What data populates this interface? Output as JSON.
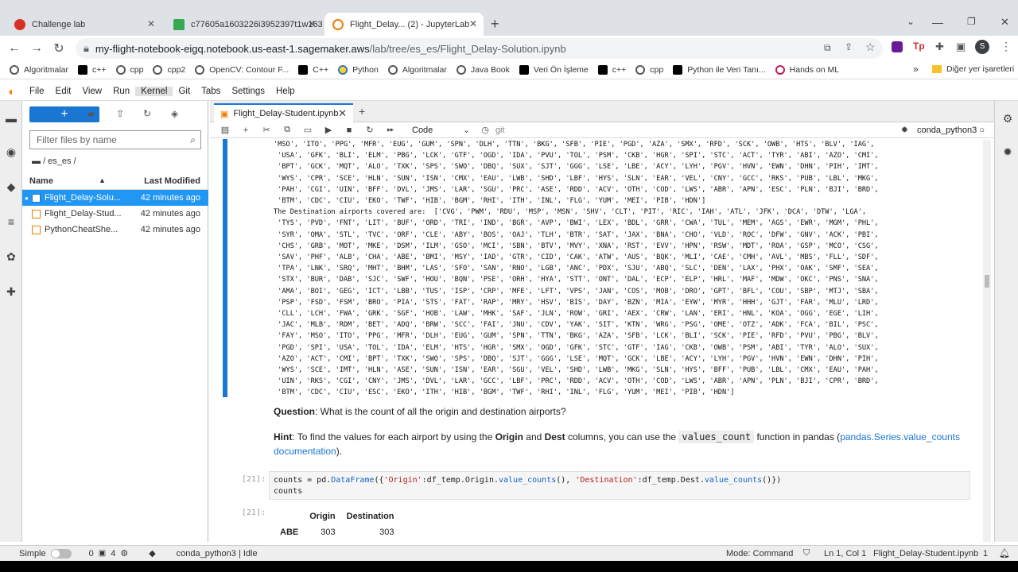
{
  "browser": {
    "tabs": [
      {
        "title": "Challenge lab",
        "icon": "red-circle-icon"
      },
      {
        "title": "c77605a1603226i3952397t1w1632:",
        "icon": "green-square-icon"
      },
      {
        "title": "Flight_Delay... (2) - JupyterLab",
        "icon": "jupyter-icon"
      }
    ],
    "url_host": "my-flight-notebook-eigq.notebook.us-east-1.sagemaker.aws",
    "url_path": "/lab/tree/es_es/Flight_Delay-Solution.ipynb",
    "bookmarks": [
      "Algoritmalar",
      "c++",
      "cpp",
      "cpp2",
      "OpenCV: Contour F...",
      "C++",
      "Python",
      "Algoritmalar",
      "Java Book",
      "Veri Ön İşleme",
      "c++",
      "cpp",
      "Python ile Veri Tanı...",
      "Hands on ML"
    ],
    "bookmarks_more": "Diğer yer işaretleri",
    "profile_letter": "S"
  },
  "menu": [
    "File",
    "Edit",
    "View",
    "Run",
    "Kernel",
    "Git",
    "Tabs",
    "Settings",
    "Help"
  ],
  "filebrowser": {
    "new_label": "+",
    "filter_placeholder": "Filter files by name",
    "breadcrumb": "/ es_es /",
    "col_name": "Name",
    "col_modified": "Last Modified",
    "files": [
      {
        "name": "Flight_Delay-Solu...",
        "modified": "42 minutes ago"
      },
      {
        "name": "Flight_Delay-Stud...",
        "modified": "42 minutes ago"
      },
      {
        "name": "PythonCheatShe...",
        "modified": "42 minutes ago"
      }
    ]
  },
  "notebook": {
    "tab_title": "Flight_Delay-Student.ipynb",
    "cell_type": "Code",
    "git_label": "git",
    "kernel": "conda_python3",
    "output_lines": [
      "'MSO', 'ITO', 'PPG', 'MFR', 'EUG', 'GUM', 'SPN', 'DLH', 'TTN', 'BKG', 'SFB', 'PIE', 'PGD', 'AZA', 'SMX', 'RFD', 'SCK', 'OWB', 'HTS', 'BLV', 'IAG',",
      " 'USA', 'GFK', 'BLI', 'ELM', 'PBG', 'LCK', 'GTF', 'OGD', 'IDA', 'PVU', 'TOL', 'PSM', 'CKB', 'HGR', 'SPI', 'STC', 'ACT', 'TYR', 'ABI', 'AZO', 'CMI',",
      " 'BPT', 'GCK', 'MQT', 'ALO', 'TXK', 'SPS', 'SWO', 'DBQ', 'SUX', 'SJT', 'GGG', 'LSE', 'LBE', 'ACY', 'LYH', 'PGV', 'HVN', 'EWN', 'DHN', 'PIH', 'IMT',",
      " 'WYS', 'CPR', 'SCE', 'HLN', 'SUN', 'ISN', 'CMX', 'EAU', 'LWB', 'SHD', 'LBF', 'HYS', 'SLN', 'EAR', 'VEL', 'CNY', 'GCC', 'RKS', 'PUB', 'LBL', 'MKG',",
      " 'PAH', 'CGI', 'UIN', 'BFF', 'DVL', 'JMS', 'LAR', 'SGU', 'PRC', 'ASE', 'RDD', 'ACV', 'OTH', 'COD', 'LWS', 'ABR', 'APN', 'ESC', 'PLN', 'BJI', 'BRD',",
      " 'BTM', 'CDC', 'CIU', 'EKO', 'TWF', 'HIB', 'BGM', 'RHI', 'ITH', 'INL', 'FLG', 'YUM', 'MEI', 'PIB', 'HDN']",
      "The Destination airports covered are:  ['CVG', 'PWM', 'RDU', 'MSP', 'MSN', 'SHV', 'CLT', 'PIT', 'RIC', 'IAH', 'ATL', 'JFK', 'DCA', 'DTW', 'LGA',",
      " 'TYS', 'PVD', 'FNT', 'LIT', 'BUF', 'ORD', 'TRI', 'IND', 'BGR', 'AVP', 'BWI', 'LEX', 'BDL', 'GRR', 'CWA', 'TUL', 'MEM', 'AGS', 'EWR', 'MGM', 'PHL',",
      " 'SYR', 'OMA', 'STL', 'TVC', 'ORF', 'CLE', 'ABY', 'BOS', 'OAJ', 'TLH', 'BTR', 'SAT', 'JAX', 'BNA', 'CHO', 'VLD', 'ROC', 'DFW', 'GNV', 'ACK', 'PBI',",
      " 'CHS', 'GRB', 'MOT', 'MKE', 'DSM', 'ILM', 'GSO', 'MCI', 'SBN', 'BTV', 'MVY', 'XNA', 'RST', 'EVV', 'HPN', 'RSW', 'MDT', 'ROA', 'GSP', 'MCO', 'CSG',",
      " 'SAV', 'PHF', 'ALB', 'CHA', 'ABE', 'BMI', 'MSY', 'IAD', 'GTR', 'CID', 'CAK', 'ATW', 'AUS', 'BQK', 'MLI', 'CAE', 'CMH', 'AVL', 'MBS', 'FLL', 'SDF',",
      " 'TPA', 'LNK', 'SRQ', 'MHT', 'BHM', 'LAS', 'SFO', 'SAN', 'RNO', 'LGB', 'ANC', 'PDX', 'SJU', 'ABQ', 'SLC', 'DEN', 'LAX', 'PHX', 'OAK', 'SMF', 'SEA',",
      " 'STX', 'BUR', 'DAB', 'SJC', 'SWF', 'HOU', 'BQN', 'PSE', 'ORH', 'HYA', 'STT', 'ONT', 'DAL', 'ECP', 'ELP', 'HRL', 'MAF', 'MDW', 'OKC', 'PNS', 'SNA',",
      " 'AMA', 'BOI', 'GEG', 'ICT', 'LBB', 'TUS', 'ISP', 'CRP', 'MFE', 'LFT', 'VPS', 'JAN', 'COS', 'MOB', 'DRO', 'GPT', 'BFL', 'COU', 'SBP', 'MTJ', 'SBA',",
      " 'PSP', 'FSD', 'FSM', 'BRO', 'PIA', 'STS', 'FAT', 'RAP', 'MRY', 'HSV', 'BIS', 'DAY', 'BZN', 'MIA', 'EYW', 'MYR', 'HHH', 'GJT', 'FAR', 'MLU', 'LRD',",
      " 'CLL', 'LCH', 'FWA', 'GRK', 'SGF', 'HOB', 'LAW', 'MHK', 'SAF', 'JLN', 'ROW', 'GRI', 'AEX', 'CRW', 'LAN', 'ERI', 'HNL', 'KOA', 'OGG', 'EGE', 'LIH',",
      " 'JAC', 'MLB', 'RDM', 'BET', 'ADQ', 'BRW', 'SCC', 'FAI', 'JNU', 'CDV', 'YAK', 'SIT', 'KTN', 'WRG', 'PSG', 'OME', 'OTZ', 'ADK', 'FCA', 'BIL', 'PSC',",
      " 'FAY', 'MSO', 'ITO', 'PPG', 'MFR', 'DLH', 'EUG', 'GUM', 'SPN', 'TTN', 'BKG', 'AZA', 'SFB', 'LCK', 'BLI', 'SCK', 'PIE', 'RFD', 'PVU', 'PBG', 'BLV',",
      " 'PGD', 'SPI', 'USA', 'TOL', 'IDA', 'ELM', 'HTS', 'HGR', 'SMX', 'OGD', 'GFK', 'STC', 'GTF', 'IAG', 'CKB', 'OWB', 'PSM', 'ABI', 'TYR', 'ALO', 'SUX',",
      " 'AZO', 'ACT', 'CMI', 'BPT', 'TXK', 'SWO', 'SPS', 'DBQ', 'SJT', 'GGG', 'LSE', 'MQT', 'GCK', 'LBE', 'ACY', 'LYH', 'PGV', 'HVN', 'EWN', 'DHN', 'PIH',",
      " 'WYS', 'SCE', 'IMT', 'HLN', 'ASE', 'SUN', 'ISN', 'EAR', 'SGU', 'VEL', 'SHD', 'LWB', 'MKG', 'SLN', 'HYS', 'BFF', 'PUB', 'LBL', 'CMX', 'EAU', 'PAH',",
      " 'UIN', 'RKS', 'CGI', 'CNY', 'JMS', 'DVL', 'LAR', 'GCC', 'LBF', 'PRC', 'RDD', 'ACV', 'OTH', 'COD', 'LWS', 'ABR', 'APN', 'PLN', 'BJI', 'CPR', 'BRD',",
      " 'BTM', 'CDC', 'CIU', 'ESC', 'EKO', 'ITH', 'HIB', 'BGM', 'TWF', 'RHI', 'INL', 'FLG', 'YUM', 'MEI', 'PIB', 'HDN']"
    ],
    "question_label": "Question",
    "question_text": ": What is the count of all the origin and destination airports?",
    "hint_label": "Hint",
    "hint_text_1": ": To find the values for each airport by using the ",
    "hint_origin": "Origin",
    "hint_and": " and ",
    "hint_dest": "Dest",
    "hint_text_2": " columns, you can use the ",
    "hint_code": "values_count",
    "hint_text_3": " function in pandas (",
    "hint_link": "pandas.Series.value_counts documentation",
    "hint_text_4": ").",
    "in_prompt": "[21]:",
    "out_prompt": "[21]:",
    "code_line1_a": "counts = pd.",
    "code_line1_b": "DataFrame",
    "code_line1_c": "({",
    "code_line1_d": "'Origin'",
    "code_line1_e": ":df_temp.Origin.",
    "code_line1_f": "value_counts",
    "code_line1_g": "(), ",
    "code_line1_h": "'Destination'",
    "code_line1_i": ":df_temp.Dest.",
    "code_line1_j": "value_counts",
    "code_line1_k": "()})",
    "code_line2": "counts",
    "table": {
      "headers": [
        "Origin",
        "Destination"
      ],
      "row": {
        "index": "ABE",
        "origin": "303",
        "destination": "303"
      }
    }
  },
  "status": {
    "mode_label": "Simple",
    "zero": "0",
    "four": "4",
    "kernel": "conda_python3 | Idle",
    "mode": "Mode: Command",
    "position": "Ln 1, Col 1",
    "file": "Flight_Delay-Student.ipynb",
    "one": "1"
  }
}
